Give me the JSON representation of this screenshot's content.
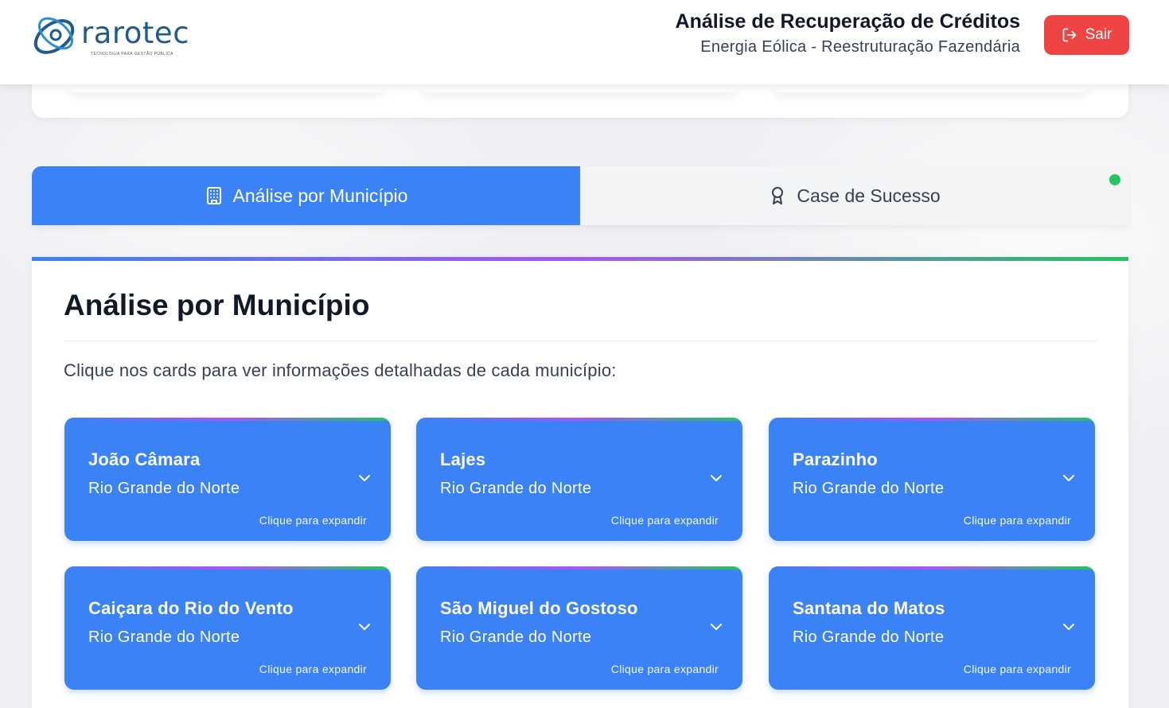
{
  "header": {
    "logo_text": "rarotec",
    "logo_tagline": "TECNOLOGIA PARA GESTÃO PÚBLICA",
    "title": "Análise de Recuperação de Créditos",
    "subtitle": "Energia Eólica - Reestruturação Fazendária",
    "logout_label": "Sair",
    "logout_icon": "logout-icon"
  },
  "tabs": [
    {
      "label": "Análise por Município",
      "icon": "building-icon",
      "active": true
    },
    {
      "label": "Case de Sucesso",
      "icon": "award-icon",
      "active": false
    }
  ],
  "panel": {
    "title": "Análise por Município",
    "description": "Clique nos cards para ver informações detalhadas de cada município:"
  },
  "municipalities": [
    {
      "name": "João Câmara",
      "state": "Rio Grande do Norte",
      "hint": "Clique para expandir"
    },
    {
      "name": "Lajes",
      "state": "Rio Grande do Norte",
      "hint": "Clique para expandir"
    },
    {
      "name": "Parazinho",
      "state": "Rio Grande do Norte",
      "hint": "Clique para expandir"
    },
    {
      "name": "Caiçara do Rio do Vento",
      "state": "Rio Grande do Norte",
      "hint": "Clique para expandir"
    },
    {
      "name": "São Miguel do Gostoso",
      "state": "Rio Grande do Norte",
      "hint": "Clique para expandir"
    },
    {
      "name": "Santana do Matos",
      "state": "Rio Grande do Norte",
      "hint": "Clique para expandir"
    }
  ],
  "colors": {
    "primary": "#3b82f6",
    "danger": "#ef4444",
    "success": "#22c55e",
    "accent_purple": "#a855f7"
  }
}
